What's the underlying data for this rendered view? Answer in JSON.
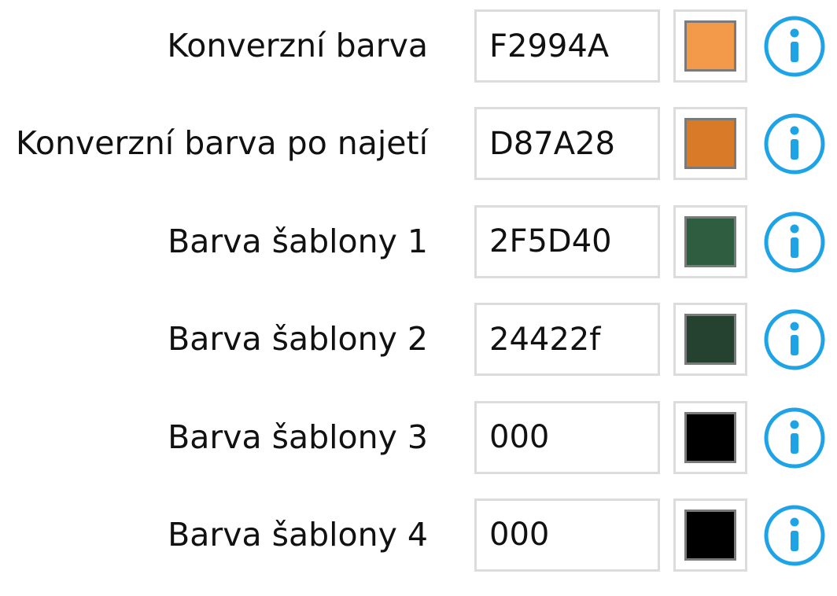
{
  "accent_color": "#1ea4e6",
  "fields": [
    {
      "label": "Konverzní barva",
      "value": "F2994A",
      "swatch_color": "#F2994A",
      "info_icon": "info-icon"
    },
    {
      "label": "Konverzní barva po najetí",
      "value": "D87A28",
      "swatch_color": "#D87A28",
      "info_icon": "info-icon"
    },
    {
      "label": "Barva šablony 1",
      "value": "2F5D40",
      "swatch_color": "#2F5D40",
      "info_icon": "info-icon"
    },
    {
      "label": "Barva šablony 2",
      "value": "24422f",
      "swatch_color": "#24422f",
      "info_icon": "info-icon"
    },
    {
      "label": "Barva šablony 3",
      "value": "000",
      "swatch_color": "#000000",
      "info_icon": "info-icon"
    },
    {
      "label": "Barva šablony 4",
      "value": "000",
      "swatch_color": "#000000",
      "info_icon": "info-icon"
    }
  ]
}
